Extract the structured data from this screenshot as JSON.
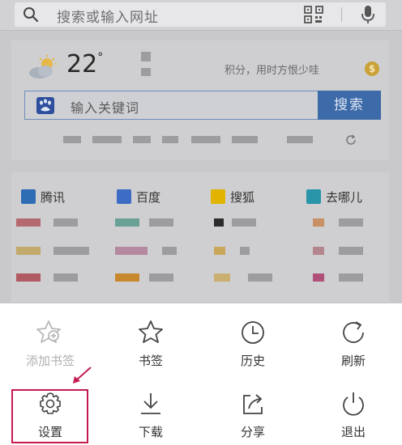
{
  "search": {
    "placeholder": "搜索或输入网址"
  },
  "weather": {
    "temperature": "22"
  },
  "points": {
    "text": "积分，用时方恨少哇",
    "coin_symbol": "$"
  },
  "baidu": {
    "placeholder": "输入关键词",
    "button": "搜索"
  },
  "sites": [
    {
      "name": "腾讯",
      "color": "#2e6db4"
    },
    {
      "name": "百度",
      "color": "#3c6cc4"
    },
    {
      "name": "搜狐",
      "color": "#e0b400"
    },
    {
      "name": "去哪儿",
      "color": "#2a95a8"
    }
  ],
  "menu": {
    "bookmark_add": "添加书签",
    "bookmarks": "书签",
    "history": "历史",
    "refresh": "刷新",
    "settings": "设置",
    "download": "下载",
    "share": "分享",
    "exit": "退出"
  },
  "colors": {
    "highlight": "#c41a4f",
    "baidu_button": "#3d6aa8",
    "coin": "#c9a136"
  }
}
